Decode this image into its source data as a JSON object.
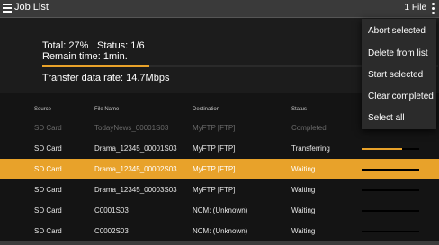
{
  "app": {
    "title": "Job List",
    "file_count": "1 File"
  },
  "icons": {
    "menu": "hamburger-menu-icon",
    "overflow": "vertical-dots-icon"
  },
  "summary": {
    "total": "Total:  27%",
    "status": "Status:   1/6",
    "remain": "Remain time:  1min.",
    "rate": "Transfer data rate:  14.7Mbps",
    "progress": 0.27
  },
  "table": {
    "headers": [
      "Source",
      "File Name",
      "Destination",
      "Status"
    ],
    "rows": [
      {
        "source": "SD Card",
        "file": "TodayNews_00001S03",
        "dest": "MyFTP [FTP]",
        "status": "Completed",
        "progress": 1.0
      },
      {
        "source": "SD Card",
        "file": "Drama_12345_00001S03",
        "dest": "MyFTP [FTP]",
        "status": "Transferring",
        "progress": 0.7
      },
      {
        "source": "SD Card",
        "file": "Drama_12345_00002S03",
        "dest": "MyFTP [FTP]",
        "status": "Waiting",
        "progress": 0.0
      },
      {
        "source": "SD Card",
        "file": "Drama_12345_00003S03",
        "dest": "MyFTP [FTP]",
        "status": "Waiting",
        "progress": 0.0
      },
      {
        "source": "SD Card",
        "file": "C0001S03",
        "dest": "NCM: (Unknown)",
        "status": "Waiting",
        "progress": 0.0
      },
      {
        "source": "SD Card",
        "file": "C0002S03",
        "dest": "NCM: (Unknown)",
        "status": "Waiting",
        "progress": 0.0
      }
    ]
  },
  "menu": {
    "items": [
      "Abort selected",
      "Delete from list",
      "Start selected",
      "Clear completed",
      "Select all"
    ]
  },
  "colors": {
    "accent": "#e8a22a"
  }
}
